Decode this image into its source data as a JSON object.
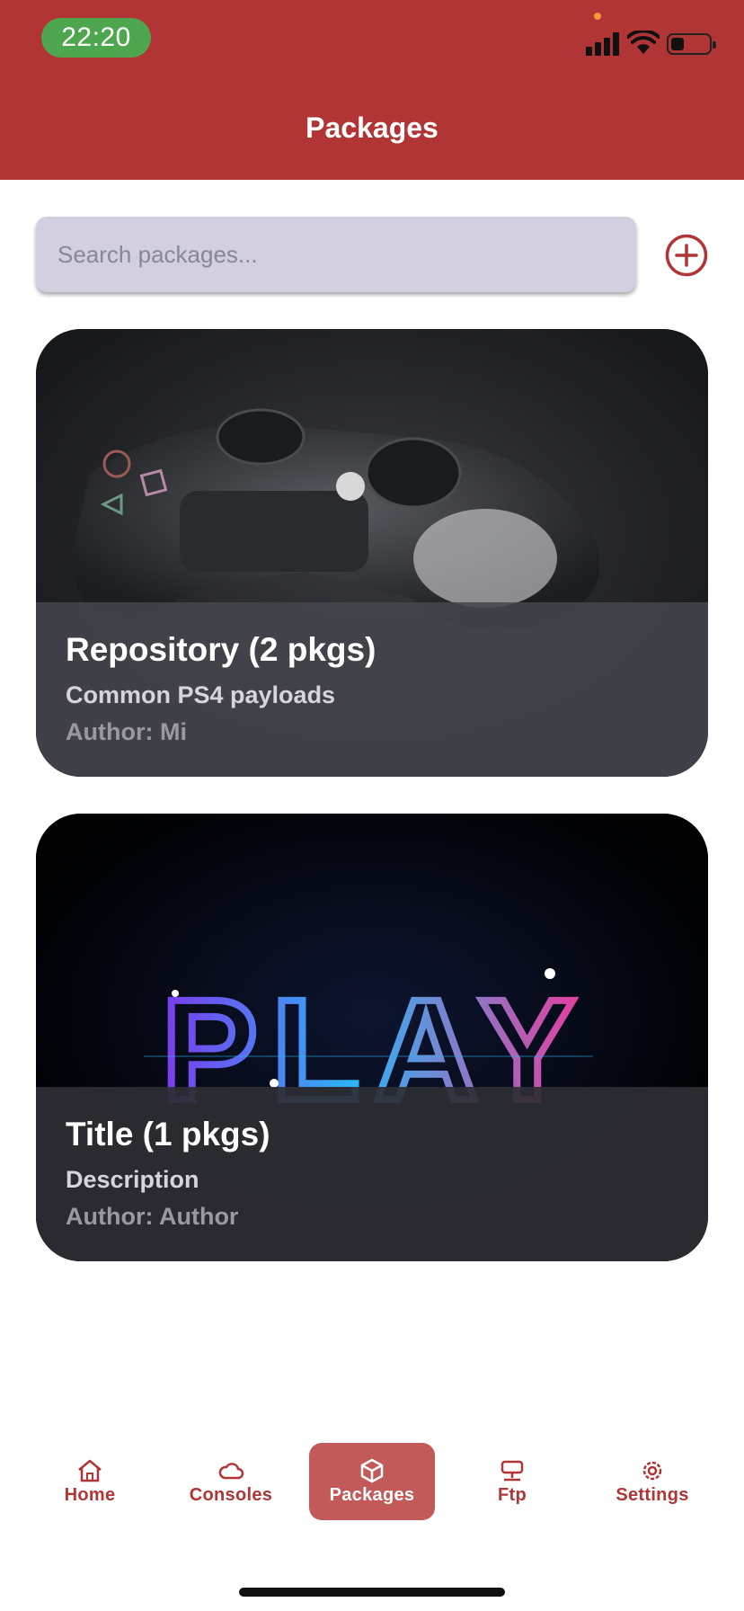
{
  "status_bar": {
    "time": "22:20",
    "accent_time_bg": "#4ea64e",
    "icons": [
      "signal-icon",
      "wifi-icon",
      "battery-icon"
    ]
  },
  "header": {
    "title": "Packages",
    "bg_color": "#b13535"
  },
  "search": {
    "placeholder": "Search packages...",
    "value": ""
  },
  "add_button_icon": "plus-circle-icon",
  "packages": [
    {
      "title": "Repository (2 pkgs)",
      "description": "Common PS4 payloads",
      "author": "Author: Mi",
      "image": "gamepad-photo"
    },
    {
      "title": "Title (1 pkgs)",
      "description": "Description",
      "author": "Author: Author",
      "image": "neon-play-art",
      "image_text": "PLAY"
    }
  ],
  "bottom_nav": {
    "items": [
      {
        "label": "Home",
        "icon": "home-icon",
        "active": false
      },
      {
        "label": "Consoles",
        "icon": "cloud-icon",
        "active": false
      },
      {
        "label": "Packages",
        "icon": "package-icon",
        "active": true
      },
      {
        "label": "Ftp",
        "icon": "server-icon",
        "active": false
      },
      {
        "label": "Settings",
        "icon": "gear-icon",
        "active": false
      }
    ]
  }
}
